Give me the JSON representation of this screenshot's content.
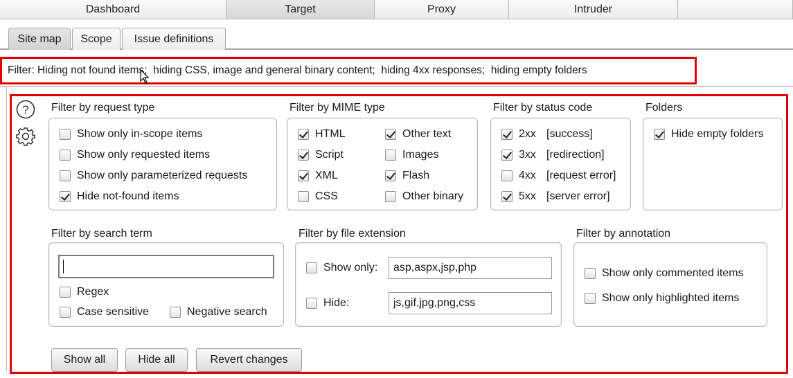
{
  "top_tabs": {
    "dashboard": "Dashboard",
    "target": "Target",
    "proxy": "Proxy",
    "intruder": "Intruder"
  },
  "sub_tabs": {
    "site_map": "Site map",
    "scope": "Scope",
    "issue_definitions": "Issue definitions"
  },
  "filter_bar": {
    "text": "Filter: Hiding not found items;  hiding CSS, image and general binary content;  hiding 4xx responses;  hiding empty folders"
  },
  "request_type": {
    "title": "Filter by request type",
    "options": [
      {
        "label": "Show only in-scope items",
        "checked": false
      },
      {
        "label": "Show only requested items",
        "checked": false
      },
      {
        "label": "Show only parameterized requests",
        "checked": false
      },
      {
        "label": "Hide not-found items",
        "checked": true
      }
    ]
  },
  "mime_type": {
    "title": "Filter by MIME type",
    "options": [
      {
        "label": "HTML",
        "checked": true
      },
      {
        "label": "Other text",
        "checked": true
      },
      {
        "label": "Script",
        "checked": true
      },
      {
        "label": "Images",
        "checked": false
      },
      {
        "label": "XML",
        "checked": true
      },
      {
        "label": "Flash",
        "checked": true
      },
      {
        "label": "CSS",
        "checked": false
      },
      {
        "label": "Other binary",
        "checked": false
      }
    ]
  },
  "status_code": {
    "title": "Filter by status code",
    "options": [
      {
        "code": "2xx",
        "desc": "[success]",
        "checked": true
      },
      {
        "code": "3xx",
        "desc": "[redirection]",
        "checked": true
      },
      {
        "code": "4xx",
        "desc": "[request error]",
        "checked": false
      },
      {
        "code": "5xx",
        "desc": "[server error]",
        "checked": true
      }
    ]
  },
  "folders": {
    "title": "Folders",
    "hide_empty_label": "Hide empty folders",
    "hide_empty_checked": true
  },
  "search_term": {
    "title": "Filter by search term",
    "value": "",
    "regex_label": "Regex",
    "case_label": "Case sensitive",
    "negative_label": "Negative search"
  },
  "file_extension": {
    "title": "Filter by file extension",
    "show_only_label": "Show only:",
    "show_only_value": "asp,aspx,jsp,php",
    "hide_label": "Hide:",
    "hide_value": "js,gif,jpg,png,css"
  },
  "annotation": {
    "title": "Filter by annotation",
    "commented_label": "Show only commented items",
    "highlighted_label": "Show only highlighted items"
  },
  "buttons": {
    "show_all": "Show all",
    "hide_all": "Hide all",
    "revert": "Revert changes"
  },
  "colors": {
    "highlight_border": "#e00000",
    "tab_active": "#d7d7d7"
  },
  "icons": {
    "help": "help-icon",
    "settings": "gear-icon"
  }
}
